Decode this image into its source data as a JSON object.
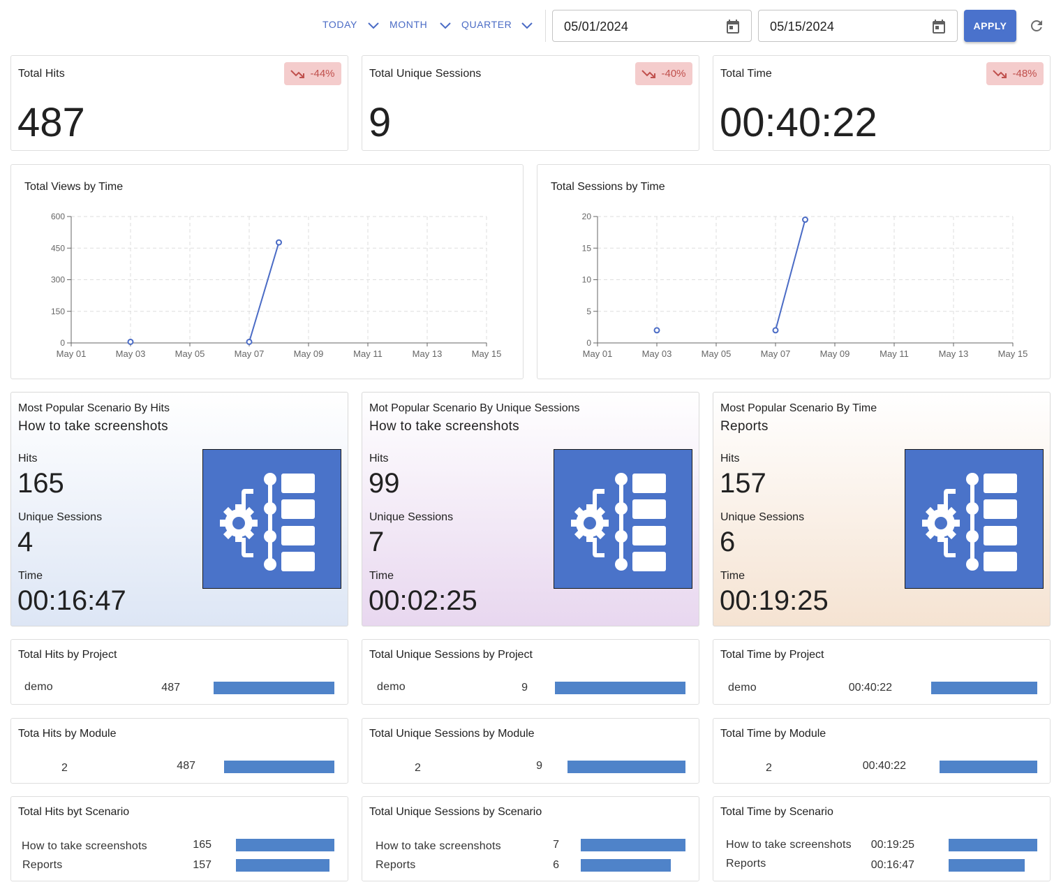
{
  "toolbar": {
    "period_today": "TODAY",
    "period_month": "MONTH",
    "period_quarter": "QUARTER",
    "start_date": "05/01/2024",
    "end_date": "05/15/2024",
    "apply_label": "APPLY"
  },
  "kpis": [
    {
      "title": "Total Hits",
      "value": "487",
      "change": "-44%"
    },
    {
      "title": "Total Unique Sessions",
      "value": "9",
      "change": "-40%"
    },
    {
      "title": "Total Time",
      "value": "00:40:22",
      "change": "-48%"
    }
  ],
  "charts": {
    "views_title": "Total Views by Time",
    "sessions_title": "Total Sessions by Time"
  },
  "chart_data": [
    {
      "type": "line",
      "title": "Total Views by Time",
      "x_ticks": [
        "May 01",
        "May 03",
        "May 05",
        "May 07",
        "May 09",
        "May 11",
        "May 13",
        "May 15"
      ],
      "ylim": [
        0,
        600
      ],
      "y_ticks": [
        0,
        150,
        300,
        450,
        600
      ],
      "grid": true,
      "segments": [
        [
          {
            "x": "2024-05-03",
            "y": 5
          }
        ],
        [
          {
            "x": "2024-05-07",
            "y": 5
          },
          {
            "x": "2024-05-08",
            "y": 477
          }
        ]
      ]
    },
    {
      "type": "line",
      "title": "Total Sessions by Time",
      "x_ticks": [
        "May 01",
        "May 03",
        "May 05",
        "May 07",
        "May 09",
        "May 11",
        "May 13",
        "May 15"
      ],
      "ylim": [
        0,
        20
      ],
      "y_ticks": [
        0,
        5,
        10,
        15,
        20
      ],
      "grid": true,
      "segments": [
        [
          {
            "x": "2024-05-03",
            "y": 2
          }
        ],
        [
          {
            "x": "2024-05-07",
            "y": 2
          },
          {
            "x": "2024-05-08",
            "y": 19.5
          }
        ]
      ]
    }
  ],
  "popular": [
    {
      "title": "Most Popular Scenario By Hits",
      "scenario": "How to take screenshots",
      "hits_label": "Hits",
      "hits": "165",
      "sessions_label": "Unique Sessions",
      "sessions": "4",
      "time_label": "Time",
      "time": "00:16:47"
    },
    {
      "title": "Mot Popular Scenario By Unique Sessions",
      "scenario": "How to take screenshots",
      "hits_label": "Hits",
      "hits": "99",
      "sessions_label": "Unique Sessions",
      "sessions": "7",
      "time_label": "Time",
      "time": "00:02:25"
    },
    {
      "title": "Most Popular Scenario By Time",
      "scenario": "Reports",
      "hits_label": "Hits",
      "hits": "157",
      "sessions_label": "Unique Sessions",
      "sessions": "6",
      "time_label": "Time",
      "time": "00:19:25"
    }
  ],
  "by_project": [
    {
      "title": "Total Hits by Project",
      "rows": [
        {
          "name": "demo",
          "value": "487",
          "fraction": 1.0
        }
      ]
    },
    {
      "title": "Total Unique Sessions by Project",
      "rows": [
        {
          "name": "demo",
          "value": "9",
          "fraction": 1.0
        }
      ]
    },
    {
      "title": "Total Time by Project",
      "rows": [
        {
          "name": "demo",
          "value": "00:40:22",
          "fraction": 1.0
        }
      ]
    }
  ],
  "by_module": [
    {
      "title": "Tota Hits by Module",
      "rows": [
        {
          "name": "2",
          "value": "487",
          "fraction": 1.0
        }
      ]
    },
    {
      "title": "Total Unique Sessions by Module",
      "rows": [
        {
          "name": "2",
          "value": "9",
          "fraction": 1.0
        }
      ]
    },
    {
      "title": "Total Time by Module",
      "rows": [
        {
          "name": "2",
          "value": "00:40:22",
          "fraction": 1.0
        }
      ]
    }
  ],
  "by_scenario": [
    {
      "title": "Total Hits byt Scenario",
      "rows": [
        {
          "name": "How to take screenshots",
          "value": "165",
          "fraction": 1.0
        },
        {
          "name": "Reports",
          "value": "157",
          "fraction": 0.95
        }
      ]
    },
    {
      "title": "Total Unique Sessions by Scenario",
      "rows": [
        {
          "name": "How to take screenshots",
          "value": "7",
          "fraction": 1.0
        },
        {
          "name": "Reports",
          "value": "6",
          "fraction": 0.86
        }
      ]
    },
    {
      "title": "Total Time by Scenario",
      "rows": [
        {
          "name": "How to take screenshots",
          "value": "00:19:25",
          "fraction": 1.0
        },
        {
          "name": "Reports",
          "value": "00:16:47",
          "fraction": 0.86
        }
      ]
    }
  ],
  "colors": {
    "accent": "#4a72cc",
    "bar": "#4f83c9",
    "trend_bg": "#f4cccc",
    "trend_fg": "#c0504d",
    "line": "#4a6bc5"
  }
}
